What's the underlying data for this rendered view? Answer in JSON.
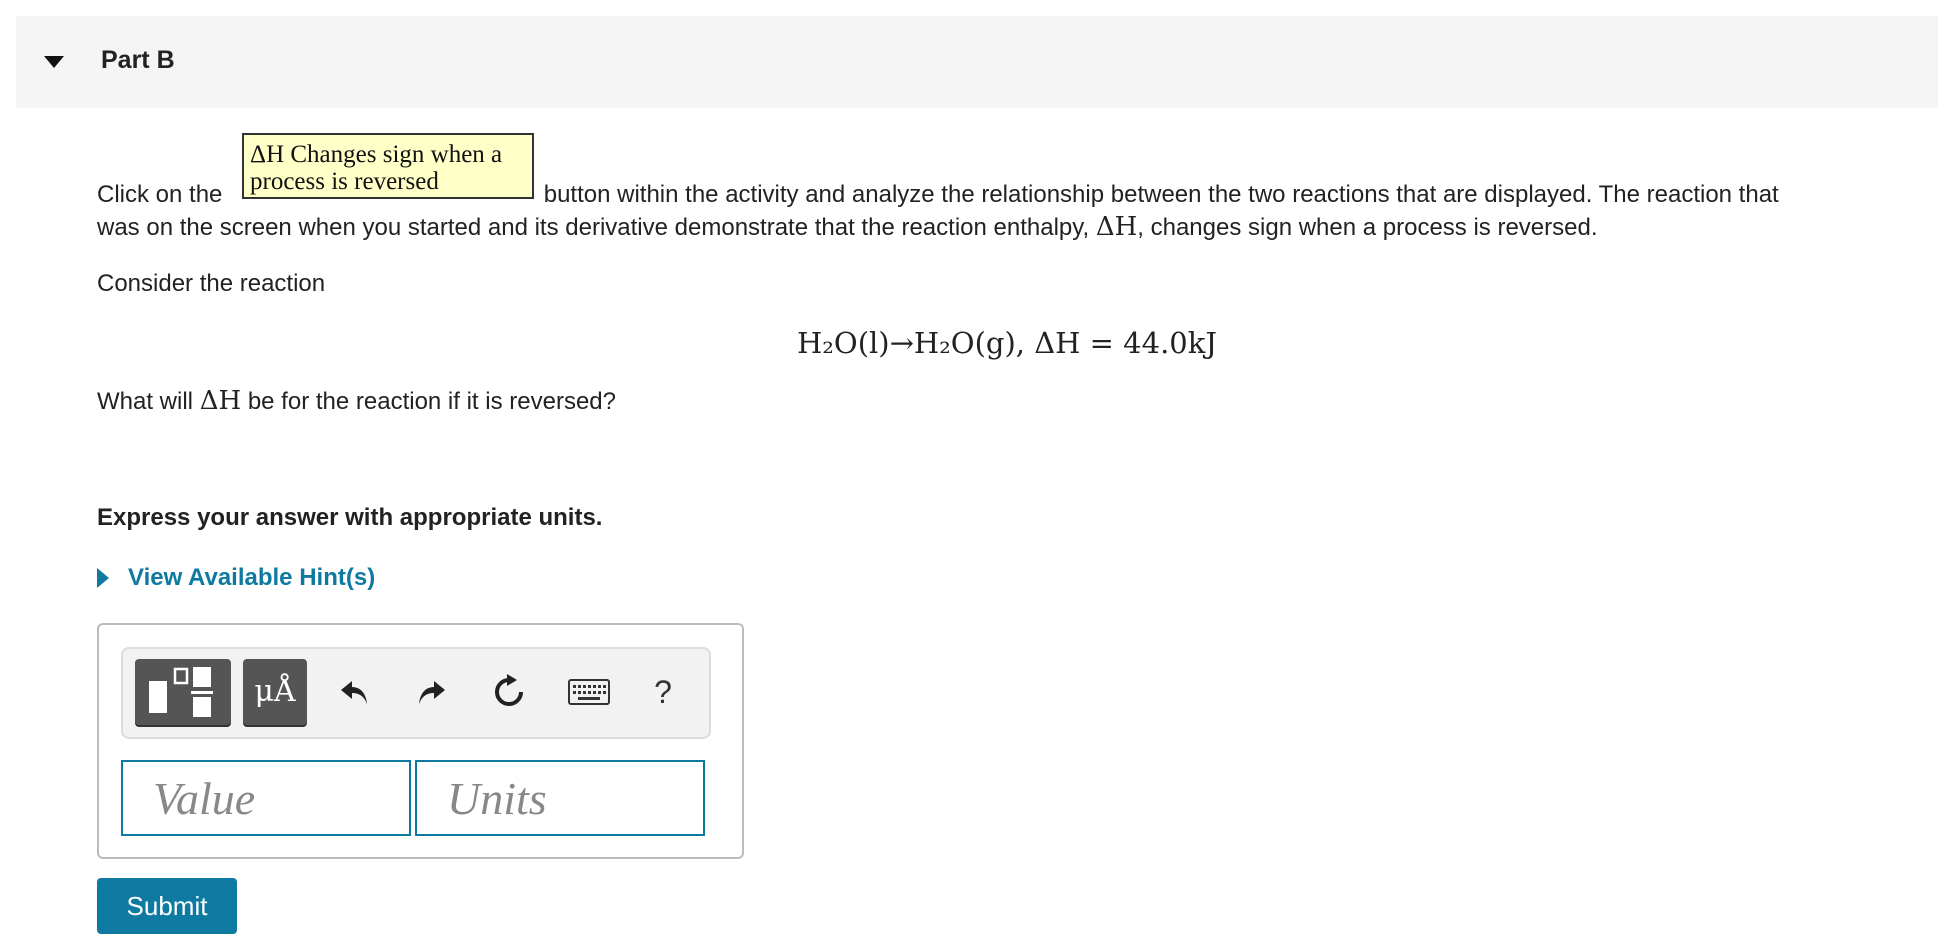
{
  "part": {
    "title": "Part B",
    "toggle_icon": "caret-down-icon"
  },
  "intro": {
    "prefix": "Click on the",
    "button_line1": "ΔH Changes sign when a",
    "button_line2": "process is reversed",
    "suffix": "button within the activity and analyze the relationship between the two reactions that are displayed. The reaction that",
    "line2_a": "was on the screen when you started and its derivative demonstrate that the reaction enthalpy,",
    "line2_b": ", changes sign when a process is reversed."
  },
  "consider": "Consider the reaction",
  "equation": {
    "text": "H₂O(l)→H₂O(g), ΔH = 44.0kJ"
  },
  "question": {
    "prefix": "What will",
    "suffix": "be for the reaction if it is reversed?"
  },
  "delta_h": "ΔH",
  "express": "Express your answer with appropriate units.",
  "hints": {
    "label": "View Available Hint(s)"
  },
  "toolbar": {
    "symbols_label": "μÅ",
    "help_label": "?",
    "icons": [
      "templates-icon",
      "undo-icon",
      "redo-icon",
      "reset-icon",
      "keyboard-icon",
      "help-icon"
    ]
  },
  "inputs": {
    "value_placeholder": "Value",
    "units_placeholder": "Units"
  },
  "submit_label": "Submit",
  "colors": {
    "accent": "#0e7aa1",
    "button_yellow": "#ffffc8",
    "toolbar_dark": "#555555"
  }
}
